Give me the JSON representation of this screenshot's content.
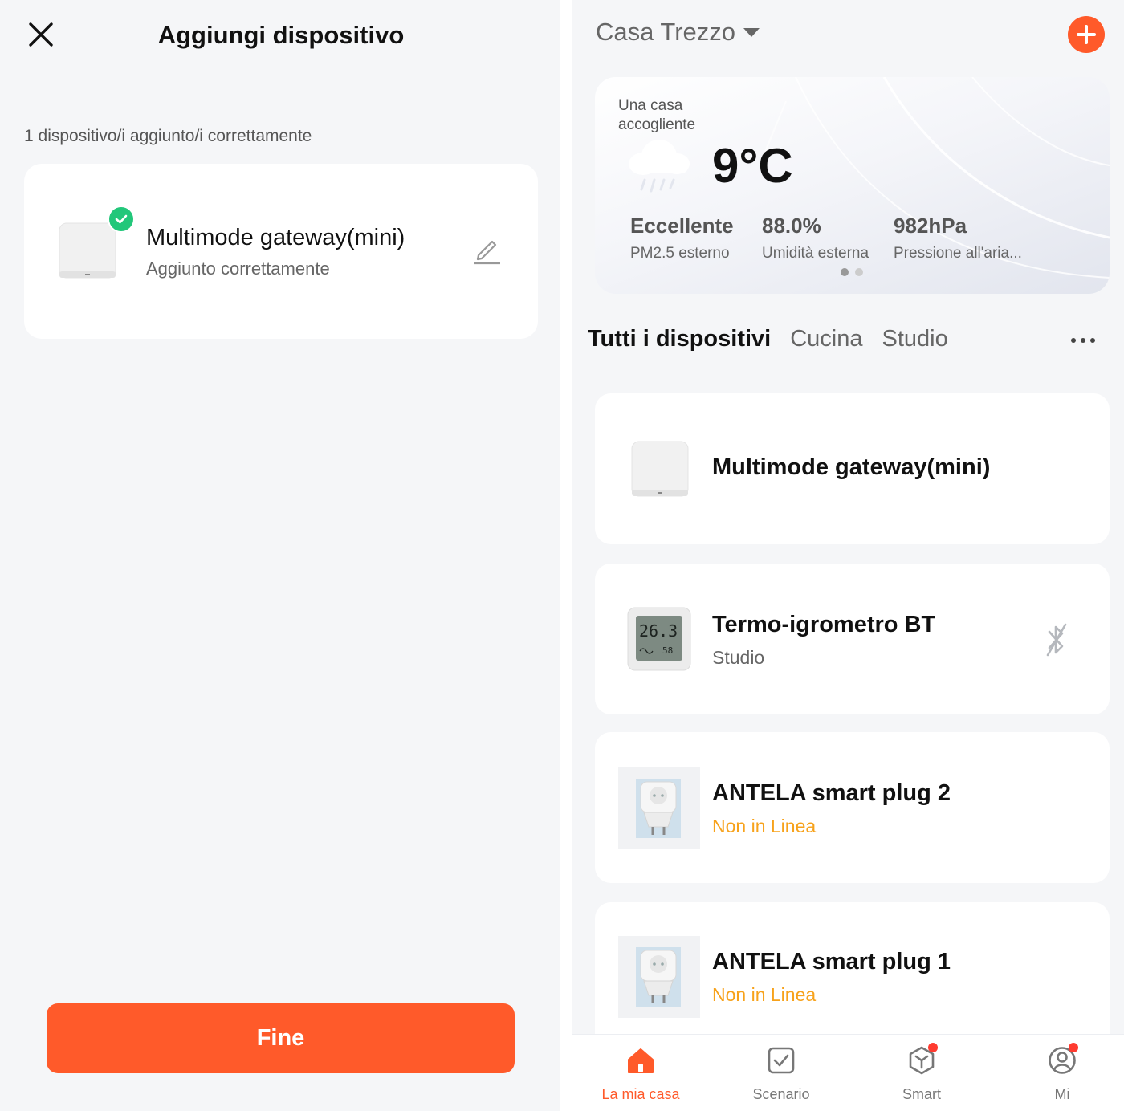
{
  "add_device_screen": {
    "title": "Aggiungi dispositivo",
    "added_count_text": "1 dispositivo/i aggiunto/i correttamente",
    "device": {
      "name": "Multimode gateway(mini)",
      "status": "Aggiunto correttamente"
    },
    "done_button": "Fine",
    "icons": {
      "close": "close-icon",
      "success": "check-icon",
      "edit": "pencil-icon"
    },
    "colors": {
      "accent": "#ff5a2a",
      "success": "#22c77a"
    }
  },
  "home_screen": {
    "home_name": "Casa Trezzo",
    "weather": {
      "label": "Una casa accogliente",
      "temperature": "9°C",
      "condition_icon": "rain-cloud-icon",
      "stats": [
        {
          "value": "Eccellente",
          "label": "PM2.5 esterno"
        },
        {
          "value": "88.0%",
          "label": "Umidità esterna"
        },
        {
          "value": "982hPa",
          "label": "Pressione all'aria..."
        }
      ],
      "page_indicator": {
        "current": 1,
        "total": 2
      }
    },
    "rooms_tabs": [
      {
        "label": "Tutti i dispositivi",
        "active": true
      },
      {
        "label": "Cucina",
        "active": false
      },
      {
        "label": "Studio",
        "active": false
      }
    ],
    "devices": [
      {
        "name": "Multimode gateway(mini)",
        "subtitle": "",
        "thumb": "gateway-icon"
      },
      {
        "name": "Termo-igrometro BT",
        "subtitle": "Studio",
        "thumb": "thermo-hygrometer-icon",
        "status_icon": "bluetooth-off-icon",
        "lcd_temp": "26.3",
        "lcd_hum": "58"
      },
      {
        "name": "ANTELA smart plug 2",
        "subtitle": "Non in Linea",
        "thumb": "smart-plug-icon"
      },
      {
        "name": "ANTELA smart plug 1",
        "subtitle": "Non in Linea",
        "thumb": "smart-plug-icon"
      }
    ],
    "tab_bar": [
      {
        "label": "La mia casa",
        "icon": "home-icon",
        "active": true,
        "badge": false
      },
      {
        "label": "Scenario",
        "icon": "scenario-checkbox-icon",
        "active": false,
        "badge": false
      },
      {
        "label": "Smart",
        "icon": "smart-cube-icon",
        "active": false,
        "badge": true
      },
      {
        "label": "Mi",
        "icon": "profile-icon",
        "active": false,
        "badge": true
      }
    ],
    "colors": {
      "accent": "#ff5a2a",
      "offline": "#f7a21b",
      "badge": "#ff3b30"
    }
  }
}
